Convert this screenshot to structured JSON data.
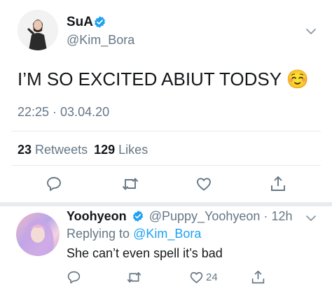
{
  "tweet": {
    "display_name": "SuA",
    "handle": "@Kim_Bora",
    "text": "I’M SO EXCITED ABIUT TODSY ☺️",
    "time": "22:25 · 03.04.20",
    "retweets_count": "23",
    "retweets_label": "Retweets",
    "likes_count": "129",
    "likes_label": "Likes"
  },
  "reply": {
    "display_name": "Yoohyeon",
    "handle": "@Puppy_Yoohyeon",
    "time": "· 12h",
    "replying_to_label": "Replying to",
    "replying_to_handle": "@Kim_Bora",
    "text": "She can’t even spell it’s bad",
    "likes": "24"
  },
  "colors": {
    "accent": "#1da1f2",
    "secondary_text": "#657786",
    "divider": "#e6ecf0"
  },
  "icons": [
    "verified-badge-icon",
    "chevron-down-icon",
    "reply-icon",
    "retweet-icon",
    "like-icon",
    "share-icon"
  ]
}
